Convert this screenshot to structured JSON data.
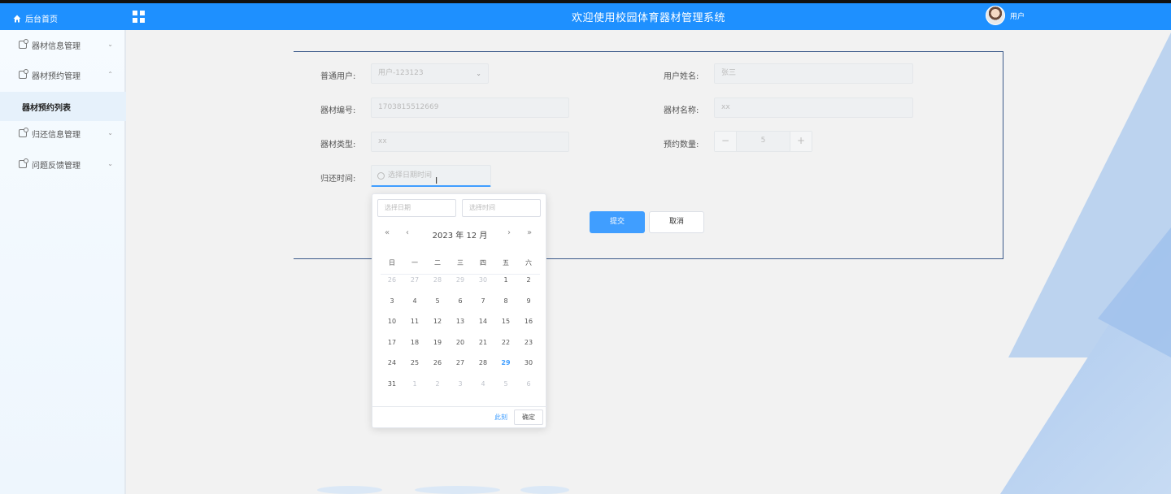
{
  "header": {
    "home_label": "后台首页",
    "title": "欢迎使用校园体育器材管理系统",
    "user_label": "用户"
  },
  "sidebar": {
    "items": [
      {
        "label": "器材信息管理",
        "chevron": "⌄"
      },
      {
        "label": "器材预约管理",
        "chevron": "⌃"
      },
      {
        "label": "归还信息管理",
        "chevron": "⌄"
      },
      {
        "label": "问题反馈管理",
        "chevron": "⌄"
      }
    ],
    "active_sub": "器材预约列表"
  },
  "form": {
    "user_account_label": "普通用户:",
    "user_account_value": "用户-123123",
    "user_name_label": "用户姓名:",
    "user_name_value": "张三",
    "equip_no_label": "器材编号:",
    "equip_no_value": "1703815512669",
    "equip_name_label": "器材名称:",
    "equip_name_value": "xx",
    "equip_type_label": "器材类型:",
    "equip_type_value": "xx",
    "reserve_qty_label": "预约数量:",
    "reserve_qty_value": "5",
    "return_time_label": "归还时间:",
    "return_time_placeholder": "选择日期时间",
    "submit_label": "提交",
    "cancel_label": "取消"
  },
  "picker": {
    "date_placeholder": "选择日期",
    "time_placeholder": "选择时间",
    "title": "2023 年 12 月",
    "weekdays": [
      "日",
      "一",
      "二",
      "三",
      "四",
      "五",
      "六"
    ],
    "weeks": [
      [
        "26",
        "27",
        "28",
        "29",
        "30",
        "1",
        "2"
      ],
      [
        "3",
        "4",
        "5",
        "6",
        "7",
        "8",
        "9"
      ],
      [
        "10",
        "11",
        "12",
        "13",
        "14",
        "15",
        "16"
      ],
      [
        "17",
        "18",
        "19",
        "20",
        "21",
        "22",
        "23"
      ],
      [
        "24",
        "25",
        "26",
        "27",
        "28",
        "29",
        "30"
      ],
      [
        "31",
        "1",
        "2",
        "3",
        "4",
        "5",
        "6"
      ]
    ],
    "today": "29",
    "now_label": "此刻",
    "confirm_label": "确定"
  },
  "colors": {
    "header": "#1e90ff",
    "accent": "#409eff"
  }
}
